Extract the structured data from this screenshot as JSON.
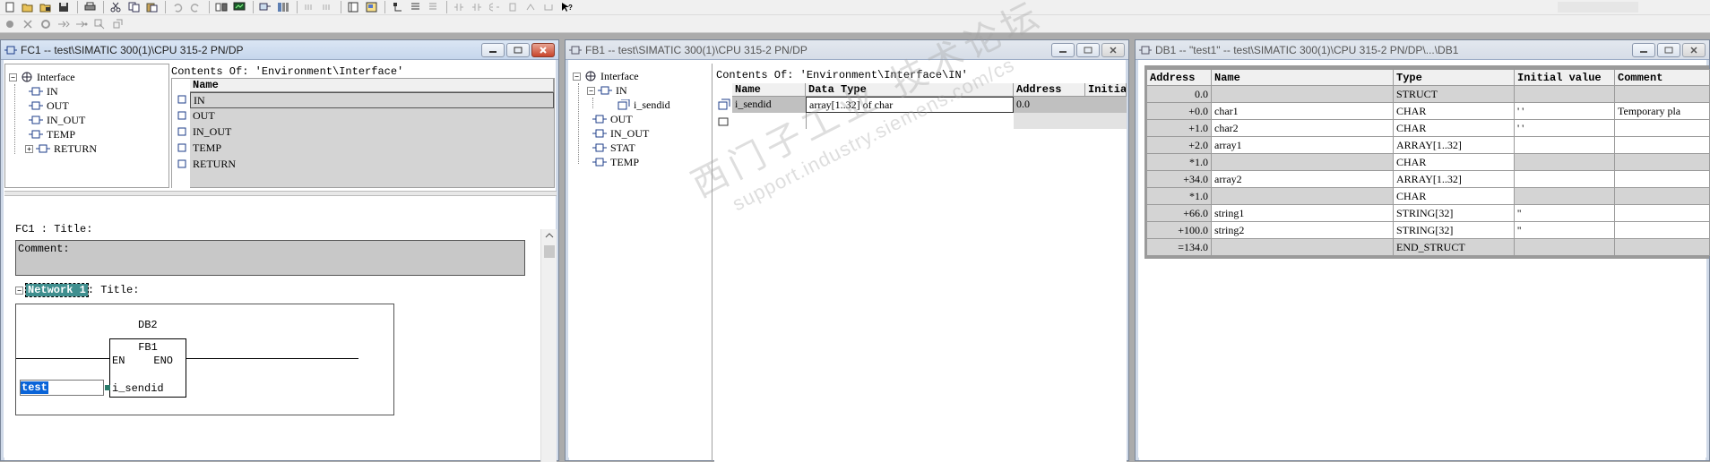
{
  "toolbar_icons": [
    "new-icon",
    "open-icon",
    "open-online-icon",
    "save-icon",
    "print-icon",
    "cut-icon",
    "copy-icon",
    "paste-icon",
    "undo-icon",
    "redo-icon",
    "download-icon",
    "monitor-icon",
    "network-icon",
    "plc-icon",
    "fbd-icon",
    "lad-icon",
    "stl-icon",
    "compare-icon",
    "overview-icon",
    "detail-icon",
    "module-icon",
    "contact-icon",
    "coil-icon",
    "branch-icon",
    "box-icon",
    "open-branch-icon",
    "close-branch-icon",
    "help-cursor-icon"
  ],
  "toolbar2_icons": [
    "stop-icon",
    "cut-row-icon",
    "insert-network-icon",
    "jump-icon",
    "link-icon",
    "copy-network-icon",
    "block-icon"
  ],
  "fc1": {
    "title": "FC1 -- test\\SIMATIC 300(1)\\CPU 315-2 PN/DP",
    "tree_root": "Interface",
    "tree_items": [
      "IN",
      "OUT",
      "IN_OUT",
      "TEMP",
      "RETURN"
    ],
    "contents_title": "Contents Of: 'Environment\\Interface'",
    "column_name": "Name",
    "rows": [
      "IN",
      "OUT",
      "IN_OUT",
      "TEMP",
      "RETURN"
    ],
    "block_title": "FC1 : Title:",
    "comment_label": "Comment:",
    "network_label": "Network 1",
    "network_title": ": Title:",
    "instance_db": "DB2",
    "block_name": "FB1",
    "en": "EN",
    "eno": "ENO",
    "param": "i_sendid",
    "input_value": "test"
  },
  "fb1": {
    "title": "FB1 -- test\\SIMATIC 300(1)\\CPU 315-2 PN/DP",
    "tree_root": "Interface",
    "tree_items": [
      "IN",
      "i_sendid",
      "OUT",
      "IN_OUT",
      "STAT",
      "TEMP"
    ],
    "contents_title": "Contents Of: 'Environment\\Interface\\IN'",
    "columns": [
      "Name",
      "Data Type",
      "Address",
      "Initia"
    ],
    "row": {
      "name": "i_sendid",
      "data_type": "array[1..32] of char",
      "address": "0.0",
      "initial": ""
    }
  },
  "db1": {
    "title": "DB1 -- \"test1\" -- test\\SIMATIC 300(1)\\CPU 315-2 PN/DP\\...\\DB1",
    "columns": [
      "Address",
      "Name",
      "Type",
      "Initial value",
      "Comment"
    ],
    "rows": [
      {
        "address": "0.0",
        "name": "",
        "type": "STRUCT",
        "initial": "",
        "comment": ""
      },
      {
        "address": "+0.0",
        "name": "char1",
        "type": "CHAR",
        "initial": "' '",
        "comment": "Temporary pla"
      },
      {
        "address": "+1.0",
        "name": "char2",
        "type": "CHAR",
        "initial": "' '",
        "comment": ""
      },
      {
        "address": "+2.0",
        "name": "array1",
        "type": "ARRAY[1..32]",
        "initial": "",
        "comment": ""
      },
      {
        "address": "*1.0",
        "name": "",
        "type": "CHAR",
        "initial": "",
        "comment": ""
      },
      {
        "address": "+34.0",
        "name": "array2",
        "type": "ARRAY[1..32]",
        "initial": "",
        "comment": ""
      },
      {
        "address": "*1.0",
        "name": "",
        "type": "CHAR",
        "initial": "",
        "comment": ""
      },
      {
        "address": "+66.0",
        "name": "string1",
        "type": "STRING[32]",
        "initial": "''",
        "comment": ""
      },
      {
        "address": "+100.0",
        "name": "string2",
        "type": "STRING[32]",
        "initial": "''",
        "comment": ""
      },
      {
        "address": "=134.0",
        "name": "",
        "type": "END_STRUCT",
        "initial": "",
        "comment": ""
      }
    ]
  },
  "watermark": {
    "line1": "西门子工业 技术论坛",
    "line2": "support.industry.siemens.com/cs"
  },
  "colors": {
    "accent": "#0a64d8",
    "network_label_bg": "#3f8f8f",
    "grey_cell": "#d4d4d4"
  }
}
